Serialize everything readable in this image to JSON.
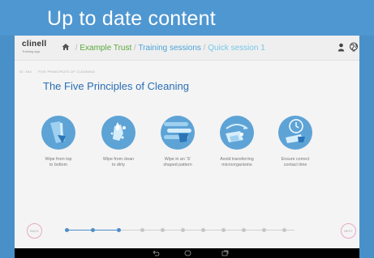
{
  "banner": {
    "title": "Up to date content"
  },
  "app": {
    "logo": {
      "name": "clinell",
      "tagline": "Training app"
    },
    "breadcrumbs": [
      {
        "label": "Example Trust",
        "color": "#5aa83c"
      },
      {
        "label": "Training sessions",
        "color": "#4aa3d8"
      },
      {
        "label": "Quick session 1",
        "color": "#79c6e9"
      }
    ],
    "separator": "/"
  },
  "module": {
    "id": "ID: 404",
    "section": "FIVE PRINCIPLES OF CLEANING",
    "title": "The Five Principles of Cleaning"
  },
  "principles": [
    {
      "icon": "wipe-top-to-bottom-icon",
      "label": "Wipe from top\nto bottom"
    },
    {
      "icon": "wipe-clean-to-dirty-icon",
      "label": "Wipe from clean\nto dirty"
    },
    {
      "icon": "s-pattern-icon",
      "label": "Wipe in an ‘S’\nshaped pattern"
    },
    {
      "icon": "avoid-transfer-icon",
      "label": "Avoid transferring\nmicroorganisms"
    },
    {
      "icon": "contact-time-icon",
      "label": "Ensure correct\ncontact time"
    }
  ],
  "progress": {
    "current_step": 3,
    "total_steps": 11
  },
  "nav": {
    "back_label": "BACK",
    "next_label": "NEXT"
  },
  "colors": {
    "accent": "#4d8ec9",
    "banner": "#4f97d1",
    "icon_circle": "#5ea3d6",
    "nav_border": "#e9a7c5"
  }
}
